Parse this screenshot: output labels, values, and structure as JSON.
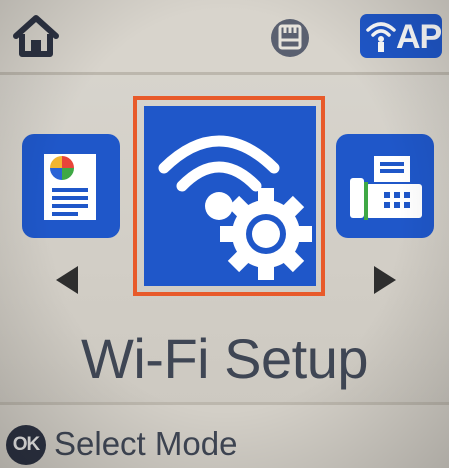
{
  "status_bar": {
    "home_icon": "home-icon",
    "memory_icon": "memory-card-icon",
    "ap_badge_text": "AP",
    "ap_icon": "wifi-ap-icon"
  },
  "menu": {
    "selected_title": "Wi-Fi Setup",
    "items": [
      {
        "icon": "copy-document-icon"
      },
      {
        "icon": "wifi-setup-gear-icon",
        "selected": true
      },
      {
        "icon": "fax-icon"
      }
    ],
    "selection_color": "#e85a2a",
    "tile_color": "#1f57c9"
  },
  "help_bar": {
    "ok_label": "OK",
    "text": "Select Mode"
  }
}
